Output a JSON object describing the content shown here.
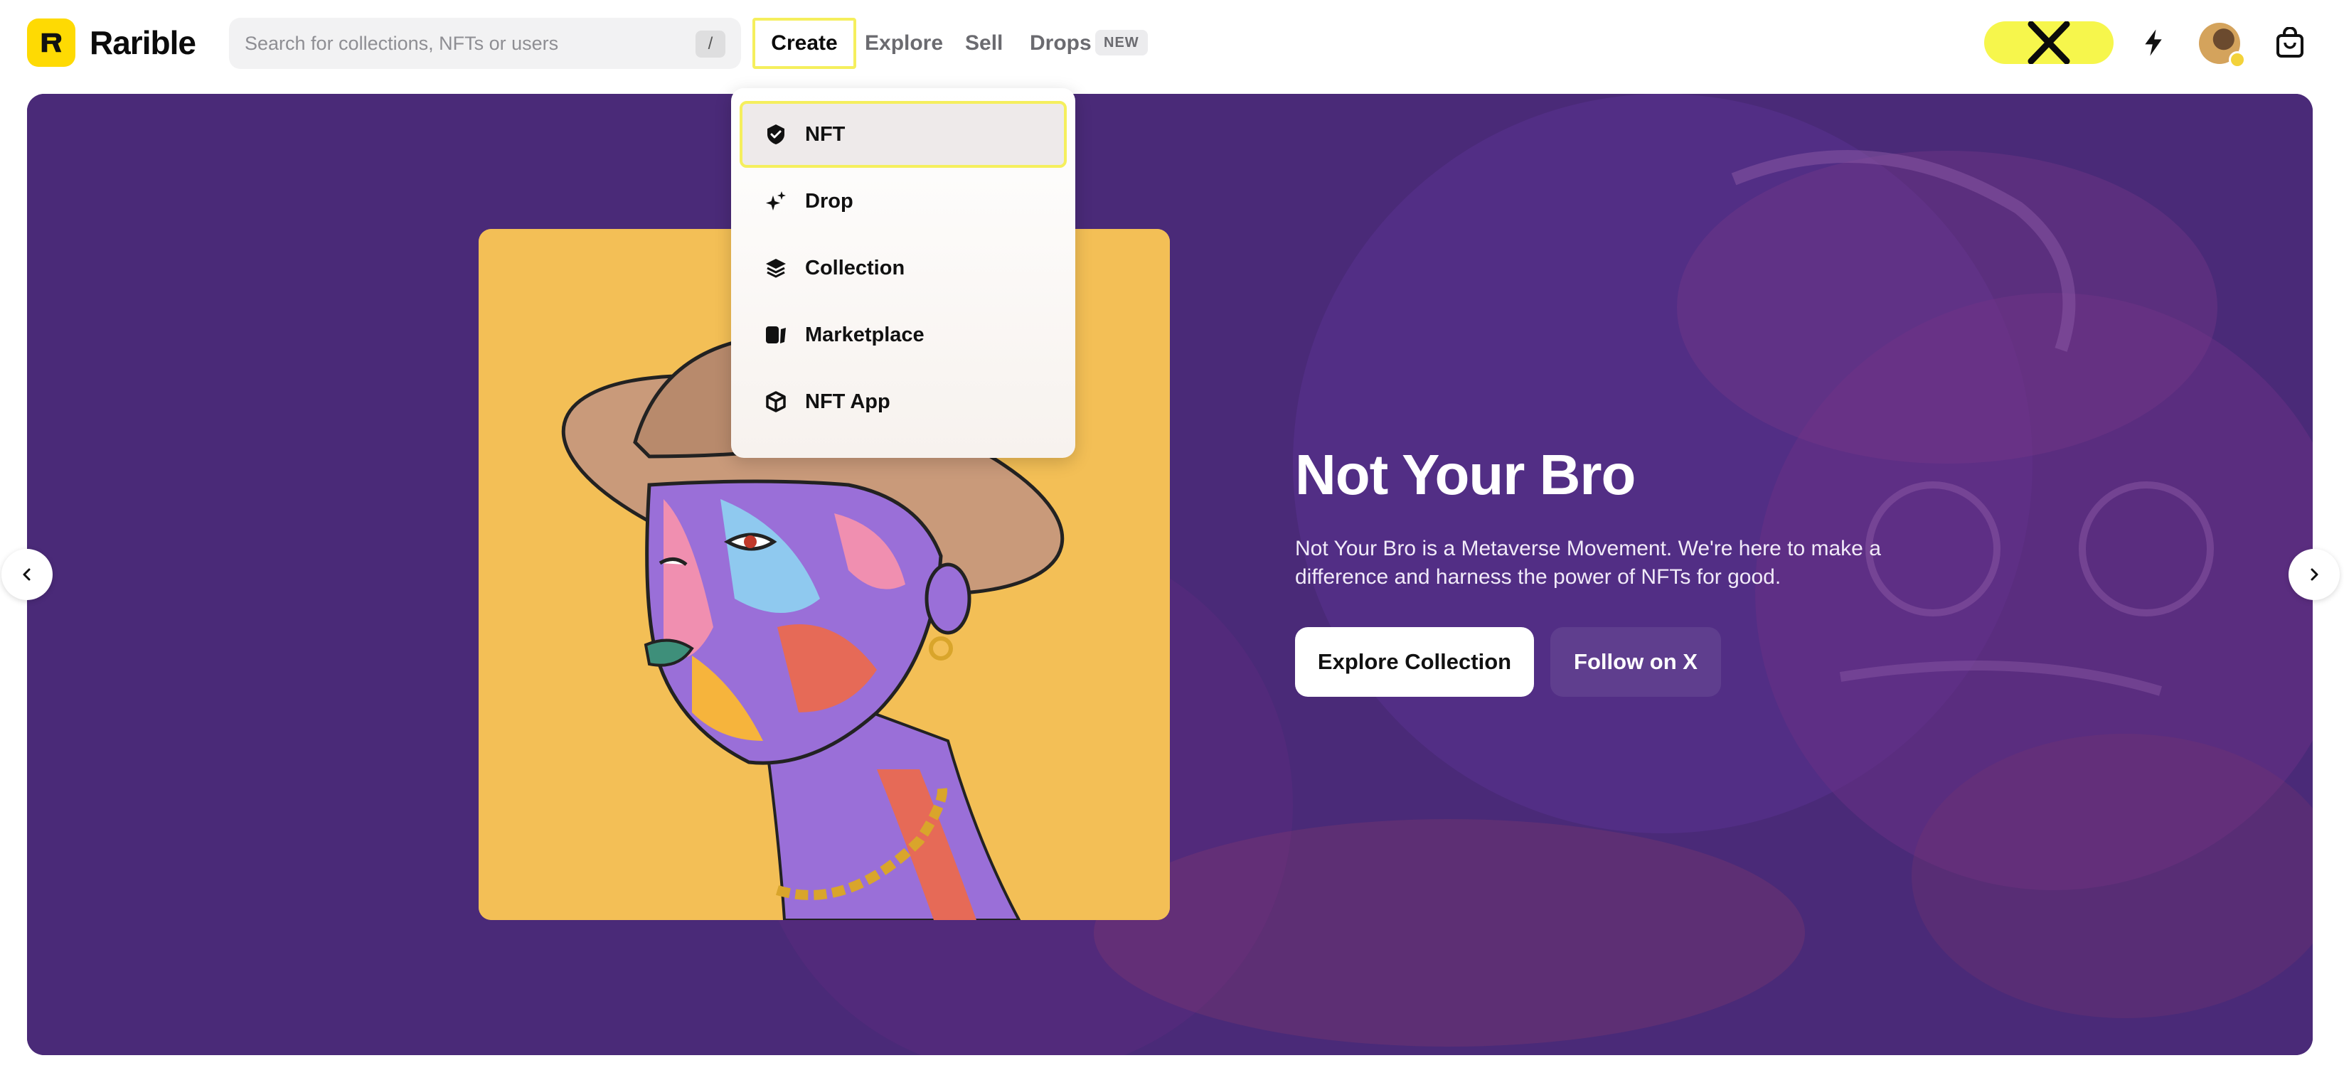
{
  "header": {
    "logo_text": "Rarible",
    "search": {
      "placeholder": "Search for collections, NFTs or users",
      "shortcut": "/"
    },
    "nav": {
      "create": "Create",
      "explore": "Explore",
      "sell": "Sell",
      "drops": "Drops",
      "drops_badge": "NEW"
    },
    "icons": [
      "x-logo-icon",
      "bolt-icon",
      "avatar",
      "shopping-bag-icon"
    ],
    "accent_color": "#FEDA03"
  },
  "dropdown": {
    "items": [
      {
        "label": "NFT",
        "icon": "shield-check-icon"
      },
      {
        "label": "Drop",
        "icon": "sparkle-icon"
      },
      {
        "label": "Collection",
        "icon": "layers-icon"
      },
      {
        "label": "Marketplace",
        "icon": "marketplace-icon"
      },
      {
        "label": "NFT App",
        "icon": "cube-icon"
      }
    ]
  },
  "hero": {
    "title": "Not Your Bro",
    "description": "Not Your Bro is a Metaverse Movement. We're here to make a difference and harness the power of NFTs for good.",
    "primary_button": "Explore Collection",
    "secondary_button": "Follow on X",
    "background_color": "#4a2a78",
    "art_background": "#f3bf56"
  }
}
